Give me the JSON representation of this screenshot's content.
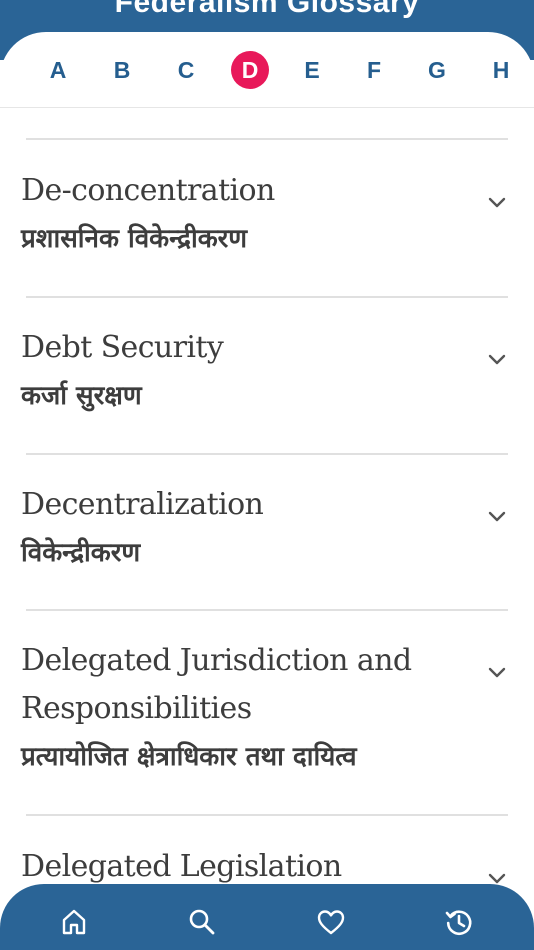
{
  "header": {
    "title": "Federalism Glossary"
  },
  "alphabet": {
    "letters": [
      "A",
      "B",
      "C",
      "D",
      "E",
      "F",
      "G",
      "H"
    ],
    "selected": "D"
  },
  "entries": [
    {
      "en": "De-concentration",
      "np": "प्रशासनिक विकेन्द्रीकरण"
    },
    {
      "en": "Debt Security",
      "np": "कर्जा सुरक्षण"
    },
    {
      "en": "Decentralization",
      "np": "विकेन्द्रीकरण"
    },
    {
      "en_line1": "Delegated Jurisdiction and",
      "en_line2": "Responsibilities",
      "np": "प्रत्यायोजित क्षेत्राधिकार तथा दायित्व"
    },
    {
      "en": "Delegated Legislation"
    }
  ],
  "bottom_nav": {
    "icons": [
      "home-icon",
      "search-icon",
      "heart-icon",
      "history-icon"
    ]
  },
  "colors": {
    "primary": "#2a6496",
    "accent": "#e8195a",
    "letter": "#255e8f",
    "text": "#3d3d3d"
  }
}
